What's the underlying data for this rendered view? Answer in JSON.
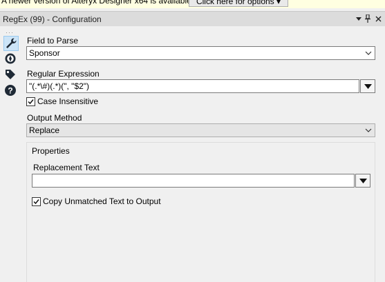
{
  "banner": {
    "message": "A newer version of Alteryx Designer x64 is available.",
    "button_label": "Click here for options ▾"
  },
  "window": {
    "title": "RegEx (99) - Configuration"
  },
  "toolstrip": {
    "tools": [
      "wrench-icon",
      "compass-icon",
      "tag-icon",
      "help-icon"
    ]
  },
  "field_to_parse": {
    "label": "Field to Parse",
    "value": "Sponsor"
  },
  "regular_expression": {
    "label": "Regular Expression",
    "value": "\"(.*\\#)(.*)(\", \"$2\")"
  },
  "case_insensitive": {
    "label": "Case Insensitive",
    "checked": true
  },
  "output_method": {
    "label": "Output Method",
    "value": "Replace"
  },
  "properties": {
    "label": "Properties",
    "replacement_text": {
      "label": "Replacement Text",
      "value": ""
    },
    "copy_unmatched": {
      "label": "Copy Unmatched Text to Output",
      "checked": true
    }
  },
  "colors": {
    "selected_tool_bg": "#cce4f7",
    "titlebar_bg": "#dcdcdc",
    "banner_bg": "#ffffe1"
  }
}
